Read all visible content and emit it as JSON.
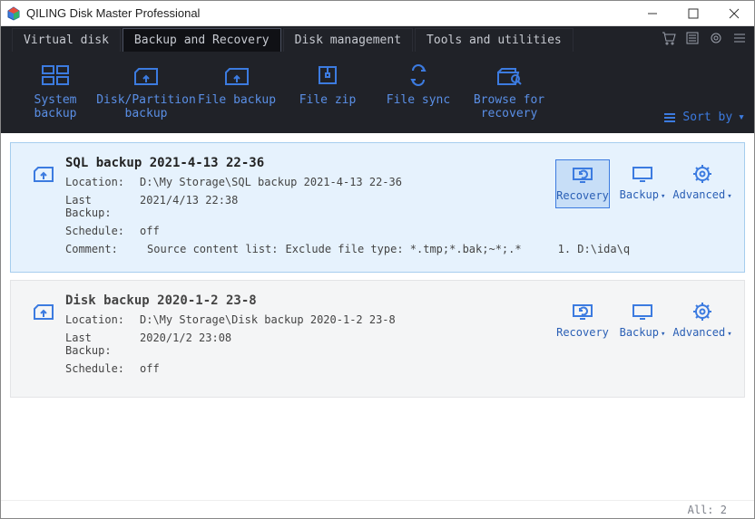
{
  "window": {
    "title": "QILING Disk Master Professional"
  },
  "tabs": {
    "items": [
      {
        "label": "Virtual disk"
      },
      {
        "label": "Backup and Recovery"
      },
      {
        "label": "Disk management"
      },
      {
        "label": "Tools and utilities"
      }
    ],
    "active_index": 1
  },
  "toolbar": {
    "items": [
      {
        "label": "System backup"
      },
      {
        "label": "Disk/Partition backup"
      },
      {
        "label": "File backup"
      },
      {
        "label": "File zip"
      },
      {
        "label": "File sync"
      },
      {
        "label": "Browse for recovery"
      }
    ],
    "sort_label": "Sort by"
  },
  "actions": {
    "recovery": "Recovery",
    "backup": "Backup",
    "advanced": "Advanced"
  },
  "field_labels": {
    "location": "Location:",
    "last_backup": "Last Backup:",
    "schedule": "Schedule:",
    "comment": "Comment:"
  },
  "backups": [
    {
      "title": "SQL backup 2021-4-13 22-36",
      "location": "D:\\My Storage\\SQL backup 2021-4-13 22-36",
      "last_backup": "2021/4/13 22:38",
      "schedule": "off",
      "comment_prefix": "Source content list:",
      "comment_mid": "Exclude file type: *.tmp;*.bak;~*;.*",
      "comment_suffix": "1. D:\\ida\\q",
      "selected": true,
      "has_comment": true
    },
    {
      "title": "Disk backup 2020-1-2 23-8",
      "location": "D:\\My Storage\\Disk backup 2020-1-2 23-8",
      "last_backup": "2020/1/2 23:08",
      "schedule": "off",
      "selected": false,
      "has_comment": false
    }
  ],
  "footer": {
    "count_label": "All:",
    "count_value": "2"
  }
}
